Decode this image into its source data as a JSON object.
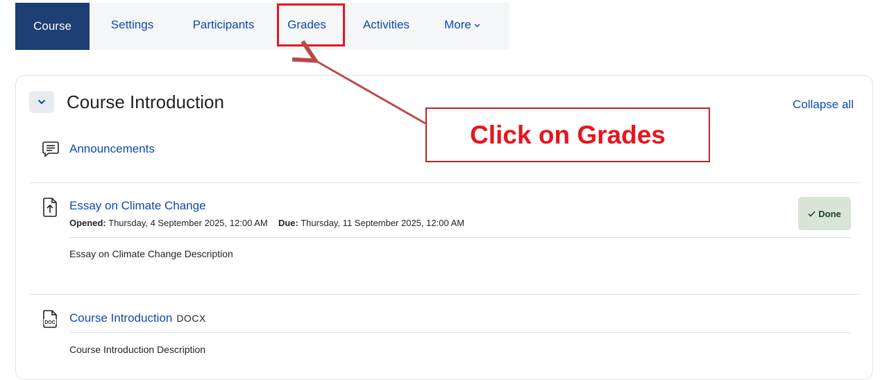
{
  "nav": {
    "tabs": [
      {
        "label": "Course",
        "active": true
      },
      {
        "label": "Settings",
        "active": false
      },
      {
        "label": "Participants",
        "active": false
      },
      {
        "label": "Grades",
        "active": false
      },
      {
        "label": "Activities",
        "active": false
      },
      {
        "label": "More",
        "active": false
      }
    ],
    "more_icon": "chevron-down-icon"
  },
  "section": {
    "title": "Course Introduction",
    "collapse_all_label": "Collapse all",
    "toggle_icon": "chevron-down-icon"
  },
  "activities": [
    {
      "icon": "forum-icon",
      "title": "Announcements"
    },
    {
      "icon": "assignment-upload-icon",
      "title": "Essay on Climate Change",
      "opened_label": "Opened:",
      "opened_value": "Thursday, 4 September 2025, 12:00 AM",
      "due_label": "Due:",
      "due_value": "Thursday, 11 September 2025, 12:00 AM",
      "completion_label": "Done",
      "completion_icon": "check-icon",
      "description": "Essay on Climate Change Description"
    },
    {
      "icon": "doc-file-icon",
      "title": "Course Introduction",
      "filetype": "DOCX",
      "description": "Course Introduction Description"
    }
  ],
  "annotation": {
    "callout_text": "Click on Grades",
    "color": "#e8141e"
  },
  "colors": {
    "active_tab_bg": "#1d3f73",
    "link": "#0f47ad",
    "done_bg": "#d7e4d6"
  }
}
